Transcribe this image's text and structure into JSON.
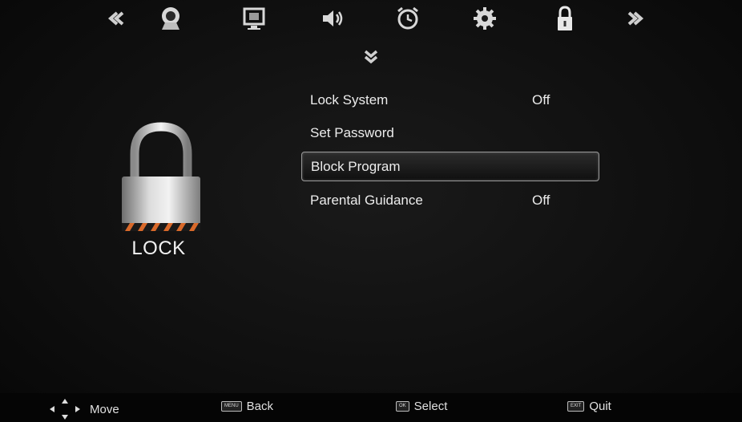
{
  "top_menu": {
    "prev_icon": "double-chevron-left-icon",
    "next_icon": "double-chevron-right-icon",
    "items": [
      {
        "name": "picture",
        "icon": "picture-icon"
      },
      {
        "name": "screen",
        "icon": "screen-icon"
      },
      {
        "name": "sound",
        "icon": "speaker-icon"
      },
      {
        "name": "time",
        "icon": "alarm-clock-icon"
      },
      {
        "name": "setup",
        "icon": "gear-icon"
      },
      {
        "name": "lock",
        "icon": "padlock-icon",
        "active": true
      }
    ]
  },
  "page": {
    "label": "LOCK",
    "icon": "padlock-icon"
  },
  "menu": {
    "items": [
      {
        "label": "Lock System",
        "value": "Off"
      },
      {
        "label": "Set Password",
        "value": ""
      },
      {
        "label": "Block Program",
        "value": "",
        "selected": true
      },
      {
        "label": "Parental Guidance",
        "value": "Off"
      }
    ]
  },
  "hints": {
    "move": "Move",
    "back_key": "MENU",
    "back": "Back",
    "select_key": "OK",
    "select": "Select",
    "quit_key": "EXIT",
    "quit": "Quit"
  },
  "colors": {
    "background": "#0c0c0c",
    "text": "#ececec",
    "highlight_border": "#9a9a9a"
  }
}
